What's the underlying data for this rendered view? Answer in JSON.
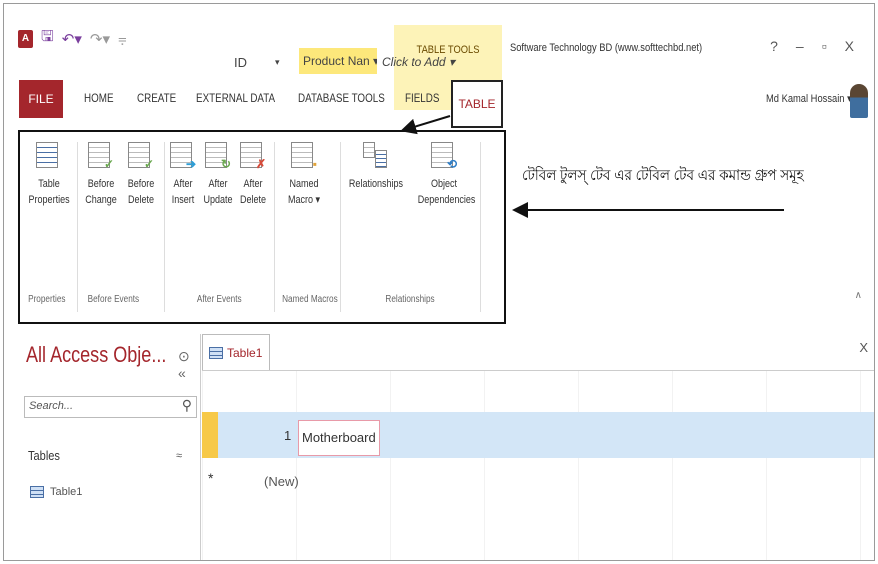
{
  "window": {
    "title": "Software Technology BD (www.softtechbd.net)",
    "context_tab_group": "TABLE TOOLS",
    "controls": [
      "?",
      "–",
      "▫",
      "X"
    ],
    "user": "Md Kamal Hossain ▾"
  },
  "qat": {
    "app_letter": "A",
    "save": "🖫",
    "undo": "↶▾",
    "redo": "↷▾",
    "more": "⩦"
  },
  "tabs": {
    "file": "FILE",
    "home": "HOME",
    "create": "CREATE",
    "external": "EXTERNAL DATA",
    "dbtools": "DATABASE TOOLS",
    "fields": "FIELDS",
    "table": "TABLE"
  },
  "ribbon": {
    "buttons": {
      "table_properties": [
        "Table",
        "Properties"
      ],
      "before_change": [
        "Before",
        "Change"
      ],
      "before_delete": [
        "Before",
        "Delete"
      ],
      "after_insert": [
        "After",
        "Insert"
      ],
      "after_update": [
        "After",
        "Update"
      ],
      "after_delete": [
        "After",
        "Delete"
      ],
      "named_macro": [
        "Named",
        "Macro ▾"
      ],
      "relationships": [
        "Relationships"
      ],
      "object_dependencies": [
        "Object",
        "Dependencies"
      ]
    },
    "groups": {
      "properties": "Properties",
      "before_events": "Before Events",
      "after_events": "After Events",
      "named_macros": "Named Macros",
      "relationships": "Relationships"
    }
  },
  "annotation": "টেবিল টুলস্ টেব এর টেবিল টেব এর কমান্ড গ্রুপ সমূহ",
  "nav": {
    "title": "All Access Obje...",
    "options": "⊙ «",
    "search_placeholder": "Search...",
    "search_icon": "⚲",
    "tables_header": "Tables",
    "tables_chev": "≈",
    "items": [
      "Table1"
    ]
  },
  "document": {
    "tab_label": "Table1",
    "close": "X",
    "columns": {
      "id": "ID",
      "product": "Product Nan ▾",
      "click_to_add": "Click to Add ▾",
      "id_arrow": "▾"
    },
    "rows": [
      {
        "id": "1",
        "product": "Motherboard"
      }
    ],
    "new_row_marker": "*",
    "new_row_label": "(New)"
  },
  "ribbon_collapse": "∧"
}
